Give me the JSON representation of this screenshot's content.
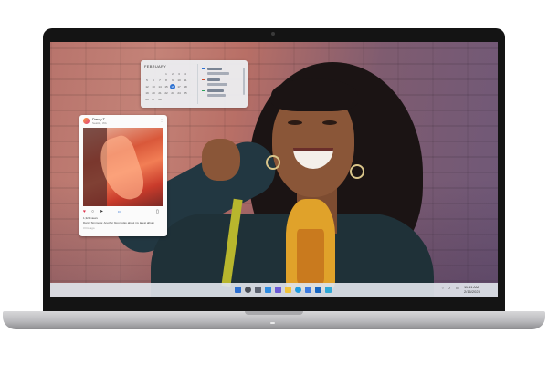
{
  "device": {
    "type": "laptop"
  },
  "desktop": {
    "calendar_widget": {
      "month_label": "FEBRUARY",
      "days": [
        "1",
        "2",
        "3",
        "4",
        "5",
        "6",
        "7",
        "8",
        "9",
        "10",
        "11",
        "12",
        "13",
        "14",
        "15",
        "16",
        "17",
        "18",
        "19",
        "20",
        "21",
        "22",
        "23",
        "24",
        "25",
        "26",
        "27",
        "28"
      ],
      "selected_day": "16"
    },
    "social_widget": {
      "account_name": "Darcy T.",
      "account_sub": "Seattle, WA",
      "liked_by": "1,321 views",
      "caption": "Darcy Simmons: Another blog today about my latest album",
      "timestamp": "3 hrs ago"
    },
    "taskbar": {
      "clock_time": "11:11 AM",
      "clock_date": "2/16/2023",
      "icons": [
        "start-icon",
        "search-icon",
        "task-view-icon",
        "widgets-icon",
        "chat-icon",
        "file-explorer-icon",
        "edge-icon",
        "store-icon",
        "mail-icon",
        "photos-icon"
      ]
    }
  },
  "colors": {
    "accent": "#2b6fd1",
    "taskbar": "#dee2e8",
    "chassis": "#c6c6c9"
  }
}
